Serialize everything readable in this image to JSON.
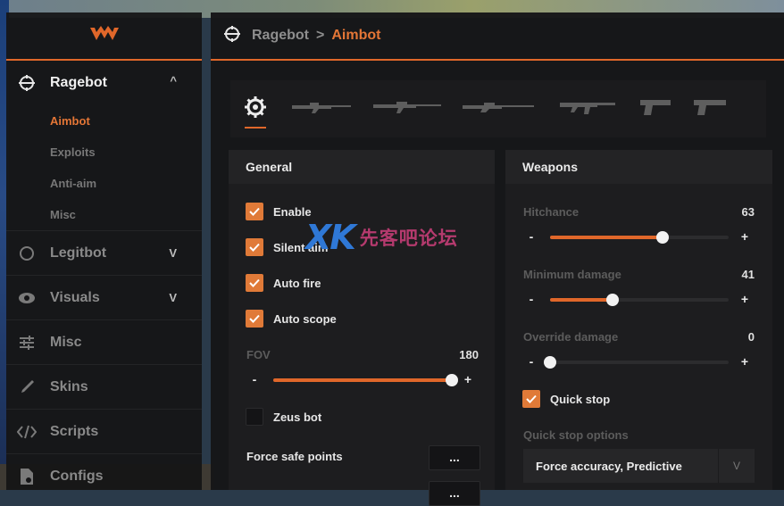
{
  "colors": {
    "accent": "#e0672a",
    "active_text": "#e47636",
    "checkbox_on": "#e07a38"
  },
  "sidebar": {
    "logo_icon": "w-logo-icon",
    "ragebot": {
      "label": "Ragebot",
      "icon": "crosshair-icon",
      "chevron": "^",
      "subitems": [
        "Aimbot",
        "Exploits",
        "Anti-aim",
        "Misc"
      ],
      "active": "Aimbot"
    },
    "items": [
      {
        "label": "Legitbot",
        "icon": "target-icon",
        "chevron": "V"
      },
      {
        "label": "Visuals",
        "icon": "eye-icon",
        "chevron": "V"
      },
      {
        "label": "Misc",
        "icon": "sliders-icon"
      },
      {
        "label": "Skins",
        "icon": "brush-icon"
      },
      {
        "label": "Scripts",
        "icon": "code-icon"
      },
      {
        "label": "Configs",
        "icon": "file-gear-icon"
      }
    ]
  },
  "breadcrumb": {
    "root": "Ragebot",
    "separator": ">",
    "current": "Aimbot"
  },
  "weapon_tabs": [
    "gear-icon",
    "auto-sniper-icon",
    "awp-icon",
    "scout-icon",
    "rifle-icon",
    "pistol-icon",
    "heavy-pistol-icon"
  ],
  "general": {
    "title": "General",
    "checkboxes": [
      {
        "label": "Enable",
        "checked": true
      },
      {
        "label": "Silent aim",
        "checked": true
      },
      {
        "label": "Auto fire",
        "checked": true
      },
      {
        "label": "Auto scope",
        "checked": true
      }
    ],
    "fov": {
      "label": "FOV",
      "value": "180",
      "minus": "-",
      "plus": "+",
      "fraction": 1.0
    },
    "zeus": {
      "label": "Zeus bot",
      "checked": false
    },
    "force_safe_points": {
      "label": "Force safe points",
      "button": "..."
    },
    "force_body_aim": {
      "button": "..."
    }
  },
  "weapons": {
    "title": "Weapons",
    "hitchance": {
      "label": "Hitchance",
      "value": "63",
      "minus": "-",
      "plus": "+",
      "fraction": 0.63
    },
    "min_damage": {
      "label": "Minimum damage",
      "value": "41",
      "minus": "-",
      "plus": "+",
      "fraction": 0.35
    },
    "override_damage": {
      "label": "Override damage",
      "value": "0",
      "minus": "-",
      "plus": "+",
      "fraction": 0.0
    },
    "quick_stop": {
      "label": "Quick stop",
      "checked": true
    },
    "quick_stop_options": {
      "label": "Quick stop options",
      "value": "Force accuracy, Predictive",
      "arrow": "V"
    }
  },
  "watermark": {
    "logo": "XK",
    "text": "先客吧论坛"
  }
}
